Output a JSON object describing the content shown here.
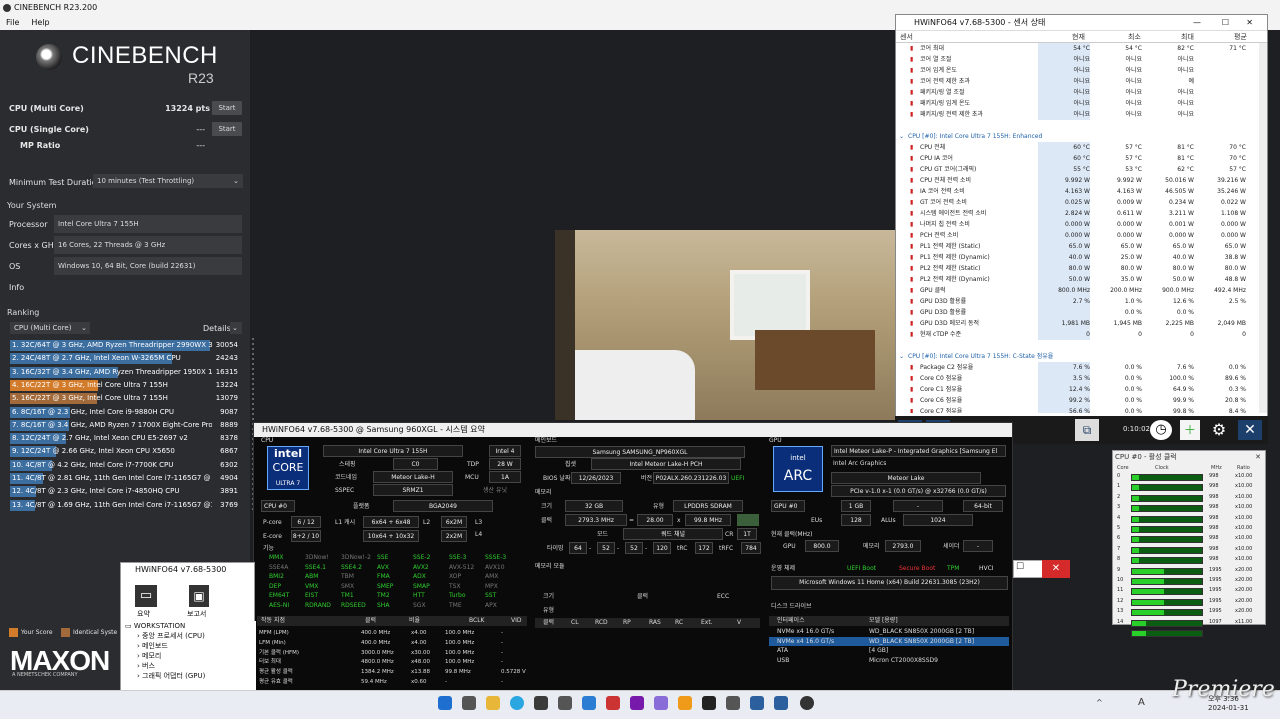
{
  "cinebench": {
    "title": "CINEBENCH R23.200",
    "menu": [
      "File",
      "Help"
    ],
    "logo": "CINEBENCH",
    "logo_sub": "R23",
    "multi_label": "CPU (Multi Core)",
    "multi_value": "13224 pts",
    "single_label": "CPU (Single Core)",
    "single_value": "---",
    "mp_label": "MP Ratio",
    "mp_value": "---",
    "start": "Start",
    "min_duration_label": "Minimum Test Duration",
    "min_duration_value": "10 minutes (Test Throttling)",
    "your_system": "Your System",
    "processor_label": "Processor",
    "processor_value": "Intel Core Ultra 7 155H",
    "cores_label": "Cores x GHz",
    "cores_value": "16 Cores, 22 Threads @ 3 GHz",
    "os_label": "OS",
    "os_value": "Windows 10, 64 Bit, Core (build 22631)",
    "info_label": "Info",
    "ranking": "Ranking",
    "ranking_select": "CPU (Multi Core)",
    "details": "Details",
    "ranks": [
      {
        "t": "1. 32C/64T @ 3 GHz, AMD Ryzen Threadripper 2990WX 32",
        "v": "30054",
        "f": 1.0,
        "c": "#3d6ea0"
      },
      {
        "t": "2. 24C/48T @ 2.7 GHz, Intel Xeon W-3265M CPU",
        "v": "24243",
        "f": 0.81,
        "c": "#3d6ea0"
      },
      {
        "t": "3. 16C/32T @ 3.4 GHz, AMD Ryzen Threadripper 1950X 16",
        "v": "16315",
        "f": 0.54,
        "c": "#3d6ea0"
      },
      {
        "t": "4. 16C/22T @ 3 GHz, Intel Core Ultra 7 155H",
        "v": "13224",
        "f": 0.44,
        "c": "#d27b2a"
      },
      {
        "t": "5. 16C/22T @ 3 GHz, Intel Core Ultra 7 155H",
        "v": "13079",
        "f": 0.435,
        "c": "#a26a3a"
      },
      {
        "t": "6. 8C/16T @ 2.3 GHz, Intel Core i9-9880H CPU",
        "v": "9087",
        "f": 0.3,
        "c": "#3d6ea0"
      },
      {
        "t": "7. 8C/16T @ 3.4 GHz, AMD Ryzen 7 1700X Eight-Core Proce",
        "v": "8889",
        "f": 0.296,
        "c": "#3d6ea0"
      },
      {
        "t": "8. 12C/24T @ 2.7 GHz, Intel Xeon CPU E5-2697 v2",
        "v": "8378",
        "f": 0.28,
        "c": "#3d6ea0"
      },
      {
        "t": "9. 12C/24T @ 2.66 GHz, Intel Xeon CPU X5650",
        "v": "6867",
        "f": 0.23,
        "c": "#3d6ea0"
      },
      {
        "t": "10. 4C/8T @ 4.2 GHz, Intel Core i7-7700K CPU",
        "v": "6302",
        "f": 0.21,
        "c": "#3d6ea0"
      },
      {
        "t": "11. 4C/8T @ 2.81 GHz, 11th Gen Intel Core i7-1165G7 @ 28",
        "v": "4904",
        "f": 0.163,
        "c": "#3d6ea0"
      },
      {
        "t": "12. 4C/8T @ 2.3 GHz, Intel Core i7-4850HQ CPU",
        "v": "3891",
        "f": 0.13,
        "c": "#3d6ea0"
      },
      {
        "t": "13. 4C/8T @ 1.69 GHz, 11th Gen Intel Core i7-1165G7 @15",
        "v": "3769",
        "f": 0.125,
        "c": "#3d6ea0"
      }
    ],
    "your_score": "Your Score",
    "identical": "Identical Syste",
    "maxon": "MAXON",
    "maxon_sub": "A NEMETSCHEK COMPANY"
  },
  "sensor": {
    "title": "HWiNFO64 v7.68-5300 - 센서 상태",
    "headers": [
      "센서",
      "현재",
      "최소",
      "최대",
      "평균"
    ],
    "rows": [
      {
        "n": "코어 최대",
        "a": "54 °C",
        "b": "54 °C",
        "c": "82 °C",
        "d": "71 °C"
      },
      {
        "n": "코어 열 조절",
        "a": "아니요",
        "b": "아니요",
        "c": "아니요",
        "d": ""
      },
      {
        "n": "코어 임계 온도",
        "a": "아니요",
        "b": "아니요",
        "c": "아니요",
        "d": ""
      },
      {
        "n": "코어 전력 제한 초과",
        "a": "아니요",
        "b": "아니요",
        "c": "예",
        "d": ""
      },
      {
        "n": "패키지/링 열 조절",
        "a": "아니요",
        "b": "아니요",
        "c": "아니요",
        "d": ""
      },
      {
        "n": "패키지/링 임계 온도",
        "a": "아니요",
        "b": "아니요",
        "c": "아니요",
        "d": ""
      },
      {
        "n": "패키지/링 전력 제한 초과",
        "a": "아니요",
        "b": "아니요",
        "c": "아니요",
        "d": ""
      },
      {
        "n": "",
        "a": "",
        "b": "",
        "c": "",
        "d": ""
      },
      {
        "n": "CPU [#0]: Intel Core Ultra 7 155H: Enhanced",
        "a": "",
        "b": "",
        "c": "",
        "d": "",
        "g": true
      },
      {
        "n": "CPU 전체",
        "a": "60 °C",
        "b": "57 °C",
        "c": "81 °C",
        "d": "70 °C"
      },
      {
        "n": "CPU IA 코어",
        "a": "60 °C",
        "b": "57 °C",
        "c": "81 °C",
        "d": "70 °C"
      },
      {
        "n": "CPU GT 코어(그래픽)",
        "a": "55 °C",
        "b": "53 °C",
        "c": "62 °C",
        "d": "57 °C"
      },
      {
        "n": "CPU 전체 전력 소비",
        "a": "9.992 W",
        "b": "9.992 W",
        "c": "50.016 W",
        "d": "39.216 W"
      },
      {
        "n": "IA 코어 전력 소비",
        "a": "4.163 W",
        "b": "4.163 W",
        "c": "46.505 W",
        "d": "35.246 W"
      },
      {
        "n": "GT 코어 전력 소비",
        "a": "0.025 W",
        "b": "0.009 W",
        "c": "0.234 W",
        "d": "0.022 W"
      },
      {
        "n": "시스템 에이전트 전력 소비",
        "a": "2.824 W",
        "b": "0.611 W",
        "c": "3.211 W",
        "d": "1.108 W"
      },
      {
        "n": "나머지 칩 전력 소비",
        "a": "0.000 W",
        "b": "0.000 W",
        "c": "0.001 W",
        "d": "0.000 W"
      },
      {
        "n": "PCH 전력 소비",
        "a": "0.000 W",
        "b": "0.000 W",
        "c": "0.000 W",
        "d": "0.000 W"
      },
      {
        "n": "PL1 전력 제한 (Static)",
        "a": "65.0 W",
        "b": "65.0 W",
        "c": "65.0 W",
        "d": "65.0 W"
      },
      {
        "n": "PL1 전력 제한 (Dynamic)",
        "a": "40.0 W",
        "b": "25.0 W",
        "c": "40.0 W",
        "d": "38.8 W"
      },
      {
        "n": "PL2 전력 제한 (Static)",
        "a": "80.0 W",
        "b": "80.0 W",
        "c": "80.0 W",
        "d": "80.0 W"
      },
      {
        "n": "PL2 전력 제한 (Dynamic)",
        "a": "50.0 W",
        "b": "35.0 W",
        "c": "50.0 W",
        "d": "48.8 W"
      },
      {
        "n": "GPU 클럭",
        "a": "800.0 MHz",
        "b": "200.0 MHz",
        "c": "900.0 MHz",
        "d": "492.4 MHz"
      },
      {
        "n": "GPU D3D 활용률",
        "a": "2.7 %",
        "b": "1.0 %",
        "c": "12.6 %",
        "d": "2.5 %"
      },
      {
        "n": "GPU D3D 활용률",
        "a": "",
        "b": "0.0 %",
        "c": "0.0 %",
        "d": ""
      },
      {
        "n": "GPU D3D 메모리 동적",
        "a": "1,981 MB",
        "b": "1,945 MB",
        "c": "2,225 MB",
        "d": "2,049 MB"
      },
      {
        "n": "현재 cTDP 수준",
        "a": "0",
        "b": "0",
        "c": "0",
        "d": "0"
      },
      {
        "n": "",
        "a": "",
        "b": "",
        "c": "",
        "d": ""
      },
      {
        "n": "CPU [#0]: Intel Core Ultra 7 155H: C-State 점유율",
        "a": "",
        "b": "",
        "c": "",
        "d": "",
        "g": true
      },
      {
        "n": "Package C2 점유율",
        "a": "7.6 %",
        "b": "0.0 %",
        "c": "7.6 %",
        "d": "0.0 %"
      },
      {
        "n": "Core C0 점유율",
        "a": "3.5 %",
        "b": "0.0 %",
        "c": "100.0 %",
        "d": "89.6 %"
      },
      {
        "n": "Core C1 점유율",
        "a": "12.4 %",
        "b": "0.0 %",
        "c": "64.9 %",
        "d": "0.3 %"
      },
      {
        "n": "Core C6 점유율",
        "a": "99.2 %",
        "b": "0.0 %",
        "c": "99.9 %",
        "d": "20.8 %"
      },
      {
        "n": "Core C7 점유율",
        "a": "56.6 %",
        "b": "0.0 %",
        "c": "99.8 %",
        "d": "8.4 %"
      }
    ],
    "timer": "0:10:02"
  },
  "summary": {
    "title": "HWiNFO64 v7.68-5300 @ Samsung 960XGL - 시스템 요약",
    "cpu": "CPU",
    "cpu_name": "Intel Core Ultra 7 155H",
    "intel_num": "Intel 4",
    "stepping_l": "스테핑",
    "stepping": "C0",
    "tdp_l": "TDP",
    "tdp": "28 W",
    "codename_l": "코드네임",
    "codename": "Meteor Lake-H",
    "mcu_l": "MCU",
    "mcu": "1A",
    "sspec_l": "SSPEC",
    "sspec": "SRMZ1",
    "prod_l": "생산 유닛",
    "platform_l": "플랫폼",
    "platform": "BGA2049",
    "cpu_sel": "CPU #0",
    "pcore_l": "P-core",
    "pcore": "6 / 12",
    "l1_l": "L1 캐시",
    "l1": "6x64 + 6x48",
    "l2_l": "L2",
    "l2": "6x2M",
    "l3_l": "L3",
    "ecore_l": "E-core",
    "ecore": "8+2 / 10",
    "l1b": "10x64 + 10x32",
    "l2b": "2x2M",
    "l4_l": "L4",
    "feat_l": "기능",
    "features": [
      [
        "MMX",
        1
      ],
      [
        "3DNow!",
        0
      ],
      [
        "3DNow!-2",
        0
      ],
      [
        "SSE",
        1
      ],
      [
        "SSE-2",
        1
      ],
      [
        "SSE-3",
        1
      ],
      [
        "SSSE-3",
        1
      ],
      [
        "SSE4A",
        0
      ],
      [
        "SSE4.1",
        1
      ],
      [
        "SSE4.2",
        1
      ],
      [
        "AVX",
        1
      ],
      [
        "AVX2",
        1
      ],
      [
        "AVX-512",
        0
      ],
      [
        "AVX10",
        0
      ],
      [
        "BMI2",
        1
      ],
      [
        "ABM",
        1
      ],
      [
        "TBM",
        0
      ],
      [
        "FMA",
        1
      ],
      [
        "ADX",
        1
      ],
      [
        "XOP",
        0
      ],
      [
        "AMX",
        0
      ],
      [
        "DEP",
        1
      ],
      [
        "VMX",
        1
      ],
      [
        "SMX",
        0
      ],
      [
        "SMEP",
        1
      ],
      [
        "SMAP",
        1
      ],
      [
        "TSX",
        0
      ],
      [
        "MPX",
        0
      ],
      [
        "EM64T",
        1
      ],
      [
        "EIST",
        1
      ],
      [
        "TM1",
        1
      ],
      [
        "TM2",
        1
      ],
      [
        "HTT",
        1
      ],
      [
        "Turbo",
        1
      ],
      [
        "SST",
        1
      ],
      [
        "AES-NI",
        1
      ],
      [
        "RDRAND",
        1
      ],
      [
        "RDSEED",
        1
      ],
      [
        "SHA",
        1
      ],
      [
        "SGX",
        0
      ],
      [
        "TME",
        0
      ],
      [
        "APX",
        0
      ]
    ],
    "op_head": [
      "작동 지점",
      "클럭",
      "비율",
      "BCLK",
      "VID"
    ],
    "op_rows": [
      [
        "MFM (LPM)",
        "400.0 MHz",
        "x4.00",
        "100.0 MHz",
        "-"
      ],
      [
        "LFM (Min)",
        "400.0 MHz",
        "x4.00",
        "100.0 MHz",
        "-"
      ],
      [
        "기본 클럭 (HFM)",
        "3000.0 MHz",
        "x30.00",
        "100.0 MHz",
        "-"
      ],
      [
        "터보 최대",
        "4800.0 MHz",
        "x48.00",
        "100.0 MHz",
        "-"
      ],
      [
        "평균 활성 클럭",
        "1384.2 MHz",
        "x13.88",
        "99.8 MHz",
        "0.5728 V"
      ],
      [
        "평균 유효 클럭",
        "59.4 MHz",
        "x0.60",
        "-",
        "-"
      ]
    ],
    "mb": "메인보드",
    "mb_name": "Samsung SAMSUNG_NP960XGL",
    "chipset_l": "칩셋",
    "chipset": "Intel Meteor Lake-H PCH",
    "bios_l": "BIOS 날짜",
    "bios_date": "12/26/2023",
    "ver_l": "버전",
    "bios_ver": "P02ALX.260.231226.03",
    "uefi": "UEFI",
    "mem": "메모리",
    "size_l": "크기",
    "size": "32 GB",
    "type_l": "유형",
    "type": "LPDDR5 SDRAM",
    "clock_l": "클럭",
    "mclk": "2793.3 MHz",
    "eq": "=",
    "mult": "28.00",
    "x": "x",
    "bclk": "99.8 MHz",
    "mode_l": "모드",
    "mode": "쿼드 채널",
    "cr_l": "CR",
    "cr": "1T",
    "timing_l": "타이밍",
    "t1": "64",
    "t2": "52",
    "t3": "52",
    "t4": "120",
    "trc_l": "tRC",
    "trc": "172",
    "trfc_l": "tRFC",
    "trfc": "784",
    "mod_l": "메모리 모듈",
    "mod_size_l": "크기",
    "mod_clk_l": "클럭",
    "ecc": "ECC",
    "mod_type_l": "유형",
    "mod_head": [
      "클럭",
      "CL",
      "RCD",
      "RP",
      "RAS",
      "RC",
      "Ext.",
      "V"
    ],
    "gpu": "GPU",
    "gpu_name": "Intel Meteor Lake-P - Integrated Graphics [Samsung El",
    "gpu_sub": "Intel Arc Graphics",
    "gpu_code": "Meteor Lake",
    "gpu_pcie": "PCIe v-1.0 x-1 (0.0 GT/s) @ x32766 (0.0 GT/s)",
    "gpu_sel": "GPU #0",
    "vram": "1 GB",
    "dash": "-",
    "bus": "64-bit",
    "eus_l": "EUs",
    "eus": "128",
    "alus_l": "ALUs",
    "alus": "1024",
    "cur_clk_l": "현재 클럭(MHz)",
    "gpu_l": "GPU",
    "gpu_clk": "800.0",
    "memclk_l": "메모리",
    "gpu_mem": "2793.0",
    "shader_l": "셰이더",
    "shader": "-",
    "os_l": "운영 체제",
    "uefi_boot": "UEFI Boot",
    "secure": "Secure Boot",
    "tpm": "TPM",
    "hvci": "HVCI",
    "os_name": "Microsoft Windows 11 Home (x64) Build 22631.3085 (23H2)",
    "drv_l": "디스크 드라이브",
    "if_l": "인터페이스",
    "model_l": "모델 [용량]",
    "drives": [
      [
        "NVMe x4 16.0 GT/s",
        "WD_BLACK SN850X 2000GB [2 TB]"
      ],
      [
        "NVMe x4 16.0 GT/s",
        "WD_BLACK SN850X 2000GB [2 TB]"
      ],
      [
        "ATA",
        "[4 GB]"
      ],
      [
        "USB",
        "Micron CT2000X8SSD9"
      ]
    ]
  },
  "hwmain": {
    "title": "HWiNFO64 v7.68-5300",
    "summary_btn": "요약",
    "save_btn": "보고서",
    "tree": [
      "WORKSTATION",
      "중앙 프로세서 (CPU)",
      "메인보드",
      "메모리",
      "버스",
      "그래픽 어댑터 (GPU)"
    ]
  },
  "activity": {
    "title": "CPU #0 - 활성 클럭",
    "head": [
      "Core",
      "Clock",
      "MHz",
      "Ratio"
    ],
    "cores": [
      [
        "0",
        0.1,
        "998",
        "x10.00"
      ],
      [
        "1",
        0.1,
        "998",
        "x10.00"
      ],
      [
        "2",
        0.1,
        "998",
        "x10.00"
      ],
      [
        "3",
        0.1,
        "998",
        "x10.00"
      ],
      [
        "4",
        0.1,
        "998",
        "x10.00"
      ],
      [
        "5",
        0.1,
        "998",
        "x10.00"
      ],
      [
        "6",
        0.1,
        "998",
        "x10.00"
      ],
      [
        "7",
        0.1,
        "998",
        "x10.00"
      ],
      [
        "8",
        0.1,
        "998",
        "x10.00"
      ],
      [
        "9",
        0.45,
        "1995",
        "x20.00"
      ],
      [
        "10",
        0.45,
        "1995",
        "x20.00"
      ],
      [
        "11",
        0.45,
        "1995",
        "x20.00"
      ],
      [
        "12",
        0.45,
        "1995",
        "x20.00"
      ],
      [
        "13",
        0.45,
        "1995",
        "x20.00"
      ],
      [
        "14",
        0.2,
        "1097",
        "x11.00"
      ],
      [
        "15",
        0.2,
        "1097",
        "x11.00"
      ]
    ]
  },
  "taskbar": {
    "time": "오후 3:36",
    "date": "2024-01-31",
    "ime": "A",
    "watermark": "Premiere"
  }
}
